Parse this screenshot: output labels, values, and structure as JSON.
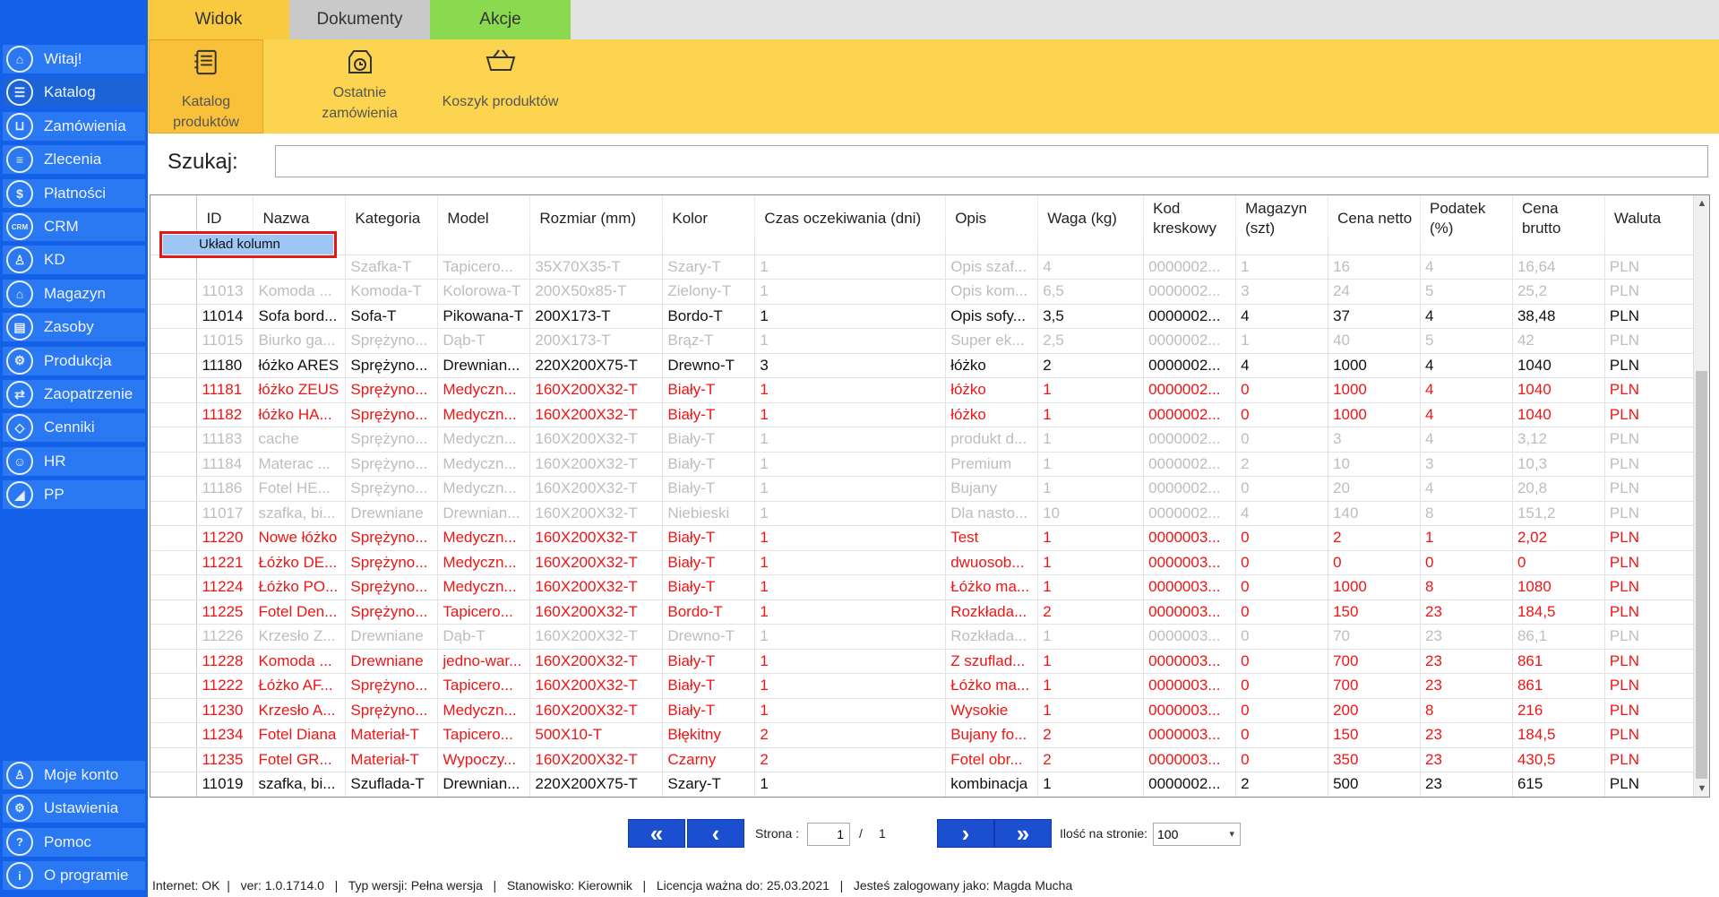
{
  "sidebar": {
    "top_items": [
      {
        "label": "Witaj!",
        "icon": "home-icon",
        "glyph": "⌂"
      },
      {
        "label": "Katalog",
        "icon": "book-icon",
        "glyph": "☰"
      },
      {
        "label": "Zamówienia",
        "icon": "cart-icon",
        "glyph": "⊔"
      },
      {
        "label": "Zlecenia",
        "icon": "list-icon",
        "glyph": "≡"
      },
      {
        "label": "Płatności",
        "icon": "dollar-icon",
        "glyph": "$"
      },
      {
        "label": "CRM",
        "icon": "crm-icon",
        "glyph": "CRM"
      },
      {
        "label": "KD",
        "icon": "user-icon",
        "glyph": "♙"
      },
      {
        "label": "Magazyn",
        "icon": "warehouse-icon",
        "glyph": "⌂"
      },
      {
        "label": "Zasoby",
        "icon": "resources-icon",
        "glyph": "▤"
      },
      {
        "label": "Produkcja",
        "icon": "production-icon",
        "glyph": "⚙"
      },
      {
        "label": "Zaopatrzenie",
        "icon": "truck-icon",
        "glyph": "⇄"
      },
      {
        "label": "Cenniki",
        "icon": "tag-icon",
        "glyph": "◇"
      },
      {
        "label": "HR",
        "icon": "hr-icon",
        "glyph": "☺"
      },
      {
        "label": "PP",
        "icon": "chart-icon",
        "glyph": "◢"
      }
    ],
    "bottom_items": [
      {
        "label": "Moje konto",
        "icon": "account-icon",
        "glyph": "♙"
      },
      {
        "label": "Ustawienia",
        "icon": "gear-icon",
        "glyph": "⚙"
      },
      {
        "label": "Pomoc",
        "icon": "help-icon",
        "glyph": "?"
      },
      {
        "label": "O programie",
        "icon": "info-icon",
        "glyph": "i"
      }
    ],
    "active_index": 1
  },
  "ribbon": {
    "tabs": [
      {
        "label": "Widok"
      },
      {
        "label": "Dokumenty"
      },
      {
        "label": "Akcje"
      }
    ],
    "buttons": [
      {
        "label": "Katalog produktów",
        "icon": "catalog-icon"
      },
      {
        "label": "Ostatnie\nzamówienia",
        "icon": "recent-orders-icon"
      },
      {
        "label": "Koszyk produktów",
        "icon": "basket-icon"
      }
    ]
  },
  "search": {
    "label": "Szukaj:",
    "value": ""
  },
  "context_menu": {
    "item": "Układ kolumn"
  },
  "table": {
    "headers": [
      "ID",
      "Nazwa",
      "Kategoria",
      "Model",
      "Rozmiar (mm)",
      "Kolor",
      "Czas oczekiwania (dni)",
      "Opis",
      "Waga (kg)",
      "Kod kreskowy",
      "Magazyn (szt)",
      "Cena netto",
      "Podatek (%)",
      "Cena brutto",
      "Waluta"
    ],
    "rows": [
      {
        "style": "gray",
        "cells": [
          "",
          "",
          "Szafka-T",
          "Tapicero...",
          "35X70X35-T",
          "Szary-T",
          "1",
          "Opis szaf...",
          "4",
          "0000002...",
          "1",
          "16",
          "4",
          "16,64",
          "PLN"
        ]
      },
      {
        "style": "gray",
        "cells": [
          "11013",
          "Komoda ...",
          "Komoda-T",
          "Kolorowa-T",
          "200X50x85-T",
          "Zielony-T",
          "1",
          "Opis kom...",
          "6,5",
          "0000002...",
          "3",
          "24",
          "5",
          "25,2",
          "PLN"
        ]
      },
      {
        "style": "black",
        "cells": [
          "11014",
          "Sofa bord...",
          "Sofa-T",
          "Pikowana-T",
          "200X173-T",
          "Bordo-T",
          "1",
          "Opis sofy...",
          "3,5",
          "0000002...",
          "4",
          "37",
          "4",
          "38,48",
          "PLN"
        ]
      },
      {
        "style": "gray",
        "cells": [
          "11015",
          "Biurko ga...",
          "Sprężyno...",
          "Dąb-T",
          "200X173-T",
          "Brąz-T",
          "1",
          "Super ek...",
          "2,5",
          "0000002...",
          "1",
          "40",
          "5",
          "42",
          "PLN"
        ]
      },
      {
        "style": "black",
        "cells": [
          "11180",
          "łóżko ARES",
          "Sprężyno...",
          "Drewnian...",
          "220X200X75-T",
          "Drewno-T",
          "3",
          "łóżko",
          "2",
          "0000002...",
          "4",
          "1000",
          "4",
          "1040",
          "PLN"
        ]
      },
      {
        "style": "red",
        "cells": [
          "11181",
          "łóżko ZEUS",
          "Sprężyno...",
          "Medyczn...",
          "160X200X32-T",
          "Biały-T",
          "1",
          "łóżko",
          "1",
          "0000002...",
          "0",
          "1000",
          "4",
          "1040",
          "PLN"
        ]
      },
      {
        "style": "red",
        "cells": [
          "11182",
          "łóżko HA...",
          "Sprężyno...",
          "Medyczn...",
          "160X200X32-T",
          "Biały-T",
          "1",
          "łóżko",
          "1",
          "0000002...",
          "0",
          "1000",
          "4",
          "1040",
          "PLN"
        ]
      },
      {
        "style": "gray",
        "cells": [
          "11183",
          "cache",
          "Sprężyno...",
          "Medyczn...",
          "160X200X32-T",
          "Biały-T",
          "1",
          "produkt d...",
          "1",
          "0000002...",
          "0",
          "3",
          "4",
          "3,12",
          "PLN"
        ]
      },
      {
        "style": "gray",
        "cells": [
          "11184",
          "Materac ...",
          "Sprężyno...",
          "Medyczn...",
          "160X200X32-T",
          "Biały-T",
          "1",
          "Premium",
          "1",
          "0000002...",
          "2",
          "10",
          "3",
          "10,3",
          "PLN"
        ]
      },
      {
        "style": "gray",
        "cells": [
          "11186",
          "Fotel HE...",
          "Sprężyno...",
          "Medyczn...",
          "160X200X32-T",
          "Biały-T",
          "1",
          "Bujany",
          "1",
          "0000002...",
          "0",
          "20",
          "4",
          "20,8",
          "PLN"
        ]
      },
      {
        "style": "gray",
        "cells": [
          "11017",
          "szafka, bi...",
          "Drewniane",
          "Drewnian...",
          "160X200X32-T",
          "Niebieski",
          "1",
          "Dla nasto...",
          "10",
          "0000002...",
          "4",
          "140",
          "8",
          "151,2",
          "PLN"
        ]
      },
      {
        "style": "red",
        "cells": [
          "11220",
          "Nowe łóżko",
          "Sprężyno...",
          "Medyczn...",
          "160X200X32-T",
          "Biały-T",
          "1",
          "Test",
          "1",
          "0000003...",
          "0",
          "2",
          "1",
          "2,02",
          "PLN"
        ]
      },
      {
        "style": "red",
        "cells": [
          "11221",
          "Łóżko DE...",
          "Sprężyno...",
          "Medyczn...",
          "160X200X32-T",
          "Biały-T",
          "1",
          "dwuosob...",
          "1",
          "0000003...",
          "0",
          "0",
          "0",
          "0",
          "PLN"
        ]
      },
      {
        "style": "red",
        "cells": [
          "11224",
          "Łóżko PO...",
          "Sprężyno...",
          "Medyczn...",
          "160X200X32-T",
          "Biały-T",
          "1",
          "Łóżko ma...",
          "1",
          "0000003...",
          "0",
          "1000",
          "8",
          "1080",
          "PLN"
        ]
      },
      {
        "style": "red",
        "cells": [
          "11225",
          "Fotel Den...",
          "Sprężyno...",
          "Tapicero...",
          "160X200X32-T",
          "Bordo-T",
          "1",
          "Rozkłada...",
          "2",
          "0000003...",
          "0",
          "150",
          "23",
          "184,5",
          "PLN"
        ]
      },
      {
        "style": "gray",
        "cells": [
          "11226",
          "Krzesło Z...",
          "Drewniane",
          "Dąb-T",
          "160X200X32-T",
          "Drewno-T",
          "1",
          "Rozkłada...",
          "1",
          "0000003...",
          "0",
          "70",
          "23",
          "86,1",
          "PLN"
        ]
      },
      {
        "style": "red",
        "cells": [
          "11228",
          "Komoda ...",
          "Drewniane",
          "jedno-war...",
          "160X200X32-T",
          "Biały-T",
          "1",
          "Z szuflad...",
          "1",
          "0000003...",
          "0",
          "700",
          "23",
          "861",
          "PLN"
        ]
      },
      {
        "style": "red",
        "cells": [
          "11222",
          "Łóżko AF...",
          "Sprężyno...",
          "Tapicero...",
          "160X200X32-T",
          "Biały-T",
          "1",
          "Łóżko ma...",
          "1",
          "0000003...",
          "0",
          "700",
          "23",
          "861",
          "PLN"
        ]
      },
      {
        "style": "red",
        "cells": [
          "11230",
          "Krzesło A...",
          "Sprężyno...",
          "Medyczn...",
          "160X200X32-T",
          "Biały-T",
          "1",
          "Wysokie",
          "1",
          "0000003...",
          "0",
          "200",
          "8",
          "216",
          "PLN"
        ]
      },
      {
        "style": "red",
        "cells": [
          "11234",
          "Fotel Diana",
          "Materiał-T",
          "Tapicero...",
          "500X10-T",
          "Błękitny",
          "2",
          "Bujany fo...",
          "2",
          "0000003...",
          "0",
          "150",
          "23",
          "184,5",
          "PLN"
        ]
      },
      {
        "style": "red",
        "cells": [
          "11235",
          "Fotel GR...",
          "Materiał-T",
          "Wypoczy...",
          "160X200X32-T",
          "Czarny",
          "2",
          "Fotel obr...",
          "2",
          "0000003...",
          "0",
          "350",
          "23",
          "430,5",
          "PLN"
        ]
      },
      {
        "style": "black",
        "cells": [
          "11019",
          "szafka, bi...",
          "Szuflada-T",
          "Drewnian...",
          "220X200X75-T",
          "Szary-T",
          "1",
          "kombinacja",
          "1",
          "0000002...",
          "2",
          "500",
          "23",
          "615",
          "PLN"
        ]
      }
    ]
  },
  "pagination": {
    "first_label": "«",
    "prev_label": "‹",
    "next_label": "›",
    "last_label": "»",
    "page_label": "Strona :",
    "current_page": "1",
    "separator": "/",
    "total_pages": "1",
    "per_page_label": "Ilość na stronie:",
    "per_page_value": "100"
  },
  "status": {
    "text": "Internet: OK  |   ver: 1.0.1714.0   |   Typ wersji: Pełna wersja   |   Stanowisko: Kierownik   |   Licencja ważna do: 25.03.2021   |   Jesteś zalogowany jako: Magda Mucha"
  },
  "colors": {
    "sidebar_bg": "#1560e8",
    "sidebar_item": "#2a78f2",
    "ribbon_yellow": "#fcd44f",
    "tab_akcje": "#8ad94e",
    "row_red": "#f01414",
    "row_gray": "#bdbdbd",
    "highlight_red": "#e01818"
  }
}
